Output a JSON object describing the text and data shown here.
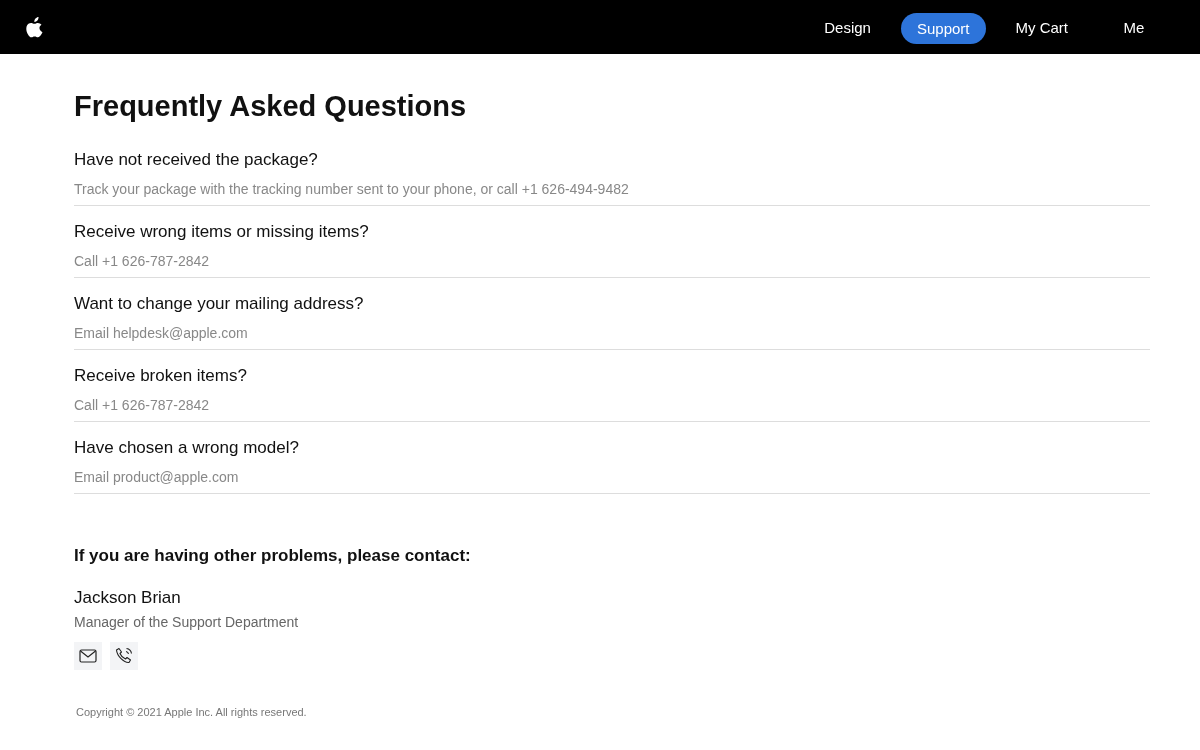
{
  "nav": [
    {
      "label": "Design",
      "selected": false
    },
    {
      "label": "Support",
      "selected": true
    },
    {
      "label": "My Cart",
      "selected": false
    },
    {
      "label": "Me",
      "selected": false
    }
  ],
  "title": "Frequently Asked Questions",
  "faqs": [
    {
      "question": "Have not received the package?",
      "answer": "Track your package with the tracking number sent to your phone, or call +1 626-494-9482"
    },
    {
      "question": "Receive wrong items or missing items?",
      "answer": "Call +1 626-787-2842"
    },
    {
      "question": "Want to change your mailing address?",
      "answer": "Email helpdesk@apple.com"
    },
    {
      "question": "Receive broken items?",
      "answer": "Call +1 626-787-2842"
    },
    {
      "question": "Have chosen a wrong model?",
      "answer": "Email product@apple.com"
    }
  ],
  "contact": {
    "heading": "If you are having other problems, please contact:",
    "name": "Jackson Brian",
    "role": "Manager of the Support Department"
  },
  "footer": "Copyright © 2021 Apple Inc. All rights reserved."
}
